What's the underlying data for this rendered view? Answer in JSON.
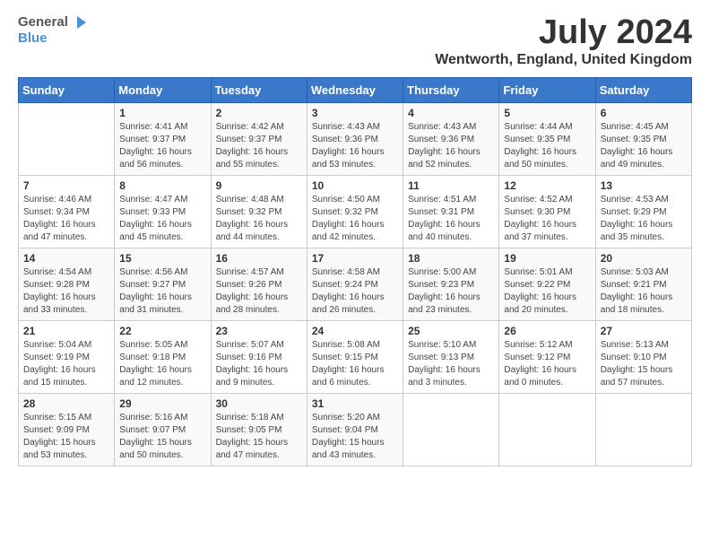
{
  "header": {
    "logo_general": "General",
    "logo_blue": "Blue",
    "month_title": "July 2024",
    "location": "Wentworth, England, United Kingdom"
  },
  "days_of_week": [
    "Sunday",
    "Monday",
    "Tuesday",
    "Wednesday",
    "Thursday",
    "Friday",
    "Saturday"
  ],
  "weeks": [
    [
      {
        "day": "",
        "info": ""
      },
      {
        "day": "1",
        "info": "Sunrise: 4:41 AM\nSunset: 9:37 PM\nDaylight: 16 hours and 56 minutes."
      },
      {
        "day": "2",
        "info": "Sunrise: 4:42 AM\nSunset: 9:37 PM\nDaylight: 16 hours and 55 minutes."
      },
      {
        "day": "3",
        "info": "Sunrise: 4:43 AM\nSunset: 9:36 PM\nDaylight: 16 hours and 53 minutes."
      },
      {
        "day": "4",
        "info": "Sunrise: 4:43 AM\nSunset: 9:36 PM\nDaylight: 16 hours and 52 minutes."
      },
      {
        "day": "5",
        "info": "Sunrise: 4:44 AM\nSunset: 9:35 PM\nDaylight: 16 hours and 50 minutes."
      },
      {
        "day": "6",
        "info": "Sunrise: 4:45 AM\nSunset: 9:35 PM\nDaylight: 16 hours and 49 minutes."
      }
    ],
    [
      {
        "day": "7",
        "info": "Sunrise: 4:46 AM\nSunset: 9:34 PM\nDaylight: 16 hours and 47 minutes."
      },
      {
        "day": "8",
        "info": "Sunrise: 4:47 AM\nSunset: 9:33 PM\nDaylight: 16 hours and 45 minutes."
      },
      {
        "day": "9",
        "info": "Sunrise: 4:48 AM\nSunset: 9:32 PM\nDaylight: 16 hours and 44 minutes."
      },
      {
        "day": "10",
        "info": "Sunrise: 4:50 AM\nSunset: 9:32 PM\nDaylight: 16 hours and 42 minutes."
      },
      {
        "day": "11",
        "info": "Sunrise: 4:51 AM\nSunset: 9:31 PM\nDaylight: 16 hours and 40 minutes."
      },
      {
        "day": "12",
        "info": "Sunrise: 4:52 AM\nSunset: 9:30 PM\nDaylight: 16 hours and 37 minutes."
      },
      {
        "day": "13",
        "info": "Sunrise: 4:53 AM\nSunset: 9:29 PM\nDaylight: 16 hours and 35 minutes."
      }
    ],
    [
      {
        "day": "14",
        "info": "Sunrise: 4:54 AM\nSunset: 9:28 PM\nDaylight: 16 hours and 33 minutes."
      },
      {
        "day": "15",
        "info": "Sunrise: 4:56 AM\nSunset: 9:27 PM\nDaylight: 16 hours and 31 minutes."
      },
      {
        "day": "16",
        "info": "Sunrise: 4:57 AM\nSunset: 9:26 PM\nDaylight: 16 hours and 28 minutes."
      },
      {
        "day": "17",
        "info": "Sunrise: 4:58 AM\nSunset: 9:24 PM\nDaylight: 16 hours and 26 minutes."
      },
      {
        "day": "18",
        "info": "Sunrise: 5:00 AM\nSunset: 9:23 PM\nDaylight: 16 hours and 23 minutes."
      },
      {
        "day": "19",
        "info": "Sunrise: 5:01 AM\nSunset: 9:22 PM\nDaylight: 16 hours and 20 minutes."
      },
      {
        "day": "20",
        "info": "Sunrise: 5:03 AM\nSunset: 9:21 PM\nDaylight: 16 hours and 18 minutes."
      }
    ],
    [
      {
        "day": "21",
        "info": "Sunrise: 5:04 AM\nSunset: 9:19 PM\nDaylight: 16 hours and 15 minutes."
      },
      {
        "day": "22",
        "info": "Sunrise: 5:05 AM\nSunset: 9:18 PM\nDaylight: 16 hours and 12 minutes."
      },
      {
        "day": "23",
        "info": "Sunrise: 5:07 AM\nSunset: 9:16 PM\nDaylight: 16 hours and 9 minutes."
      },
      {
        "day": "24",
        "info": "Sunrise: 5:08 AM\nSunset: 9:15 PM\nDaylight: 16 hours and 6 minutes."
      },
      {
        "day": "25",
        "info": "Sunrise: 5:10 AM\nSunset: 9:13 PM\nDaylight: 16 hours and 3 minutes."
      },
      {
        "day": "26",
        "info": "Sunrise: 5:12 AM\nSunset: 9:12 PM\nDaylight: 16 hours and 0 minutes."
      },
      {
        "day": "27",
        "info": "Sunrise: 5:13 AM\nSunset: 9:10 PM\nDaylight: 15 hours and 57 minutes."
      }
    ],
    [
      {
        "day": "28",
        "info": "Sunrise: 5:15 AM\nSunset: 9:09 PM\nDaylight: 15 hours and 53 minutes."
      },
      {
        "day": "29",
        "info": "Sunrise: 5:16 AM\nSunset: 9:07 PM\nDaylight: 15 hours and 50 minutes."
      },
      {
        "day": "30",
        "info": "Sunrise: 5:18 AM\nSunset: 9:05 PM\nDaylight: 15 hours and 47 minutes."
      },
      {
        "day": "31",
        "info": "Sunrise: 5:20 AM\nSunset: 9:04 PM\nDaylight: 15 hours and 43 minutes."
      },
      {
        "day": "",
        "info": ""
      },
      {
        "day": "",
        "info": ""
      },
      {
        "day": "",
        "info": ""
      }
    ]
  ]
}
